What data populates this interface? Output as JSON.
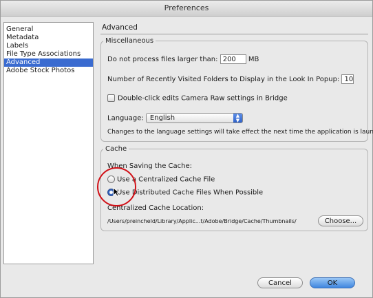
{
  "window": {
    "title": "Preferences"
  },
  "sidebar": {
    "items": [
      {
        "label": "General",
        "selected": false
      },
      {
        "label": "Metadata",
        "selected": false
      },
      {
        "label": "Labels",
        "selected": false
      },
      {
        "label": "File Type Associations",
        "selected": false
      },
      {
        "label": "Advanced",
        "selected": true
      },
      {
        "label": "Adobe Stock Photos",
        "selected": false
      }
    ]
  },
  "advanced": {
    "header": "Advanced",
    "misc": {
      "legend": "Miscellaneous",
      "max_file_label": "Do not process files larger than:",
      "max_file_value": "200",
      "max_file_unit": "MB",
      "recent_folders_label": "Number of Recently Visited Folders to Display in the Look In Popup:",
      "recent_folders_value": "10",
      "double_click_label": "Double-click edits Camera Raw settings in Bridge",
      "language_label": "Language:",
      "language_value": "English",
      "language_note": "Changes to the language settings will take effect the next time the application is launched."
    },
    "cache": {
      "legend": "Cache",
      "when_saving": "When Saving the Cache:",
      "option_centralized": "Use a Centralized Cache File",
      "option_distributed": "Use Distributed Cache Files When Possible",
      "location_label": "Centralized Cache Location:",
      "location_path": "/Users/preincheld/Library/Applic...t/Adobe/Bridge/Cache/Thumbnails/",
      "choose_button": "Choose..."
    }
  },
  "buttons": {
    "cancel": "Cancel",
    "ok": "OK"
  },
  "colors": {
    "selection": "#3a6bd0",
    "highlight_circle": "#d10f16",
    "ok_button": "#3f86df"
  }
}
